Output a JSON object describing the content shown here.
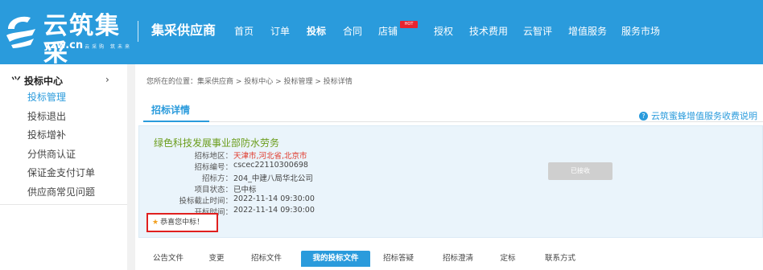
{
  "header": {
    "logo_title": "云筑集采",
    "logo_domain": "yzw.cn",
    "logo_tagline": "云采购 筑未来",
    "brand": "集采供应商",
    "nav": [
      {
        "label": "首页"
      },
      {
        "label": "订单"
      },
      {
        "label": "投标",
        "active": true
      },
      {
        "label": "合同"
      },
      {
        "label": "店铺",
        "badge": "HOT"
      },
      {
        "label": "授权"
      },
      {
        "label": "技术费用"
      },
      {
        "label": "云智评"
      },
      {
        "label": "增值服务"
      },
      {
        "label": "服务市场"
      }
    ]
  },
  "sidebar": {
    "section_label": "投标中心",
    "section_icon": "bid-hammer-icon",
    "items": [
      {
        "label": "投标管理",
        "active": true
      },
      {
        "label": "投标退出"
      },
      {
        "label": "投标增补"
      },
      {
        "label": "分供商认证"
      },
      {
        "label": "保证金支付订单"
      },
      {
        "label": "供应商常见问题"
      }
    ]
  },
  "main": {
    "breadcrumb": "您所在的位置：集采供应商 > 投标中心 > 投标管理 > 投标详情",
    "section_title": "招标详情",
    "help_link": "云筑蜜蜂增值服务收费说明",
    "project": {
      "title": "绿色科技发展事业部防水劳务",
      "fields": [
        {
          "label": "招标地区：",
          "value": "天津市,河北省,北京市",
          "highlight": true
        },
        {
          "label": "招标编号：",
          "value": "cscec22110300698"
        },
        {
          "label": "招标方：",
          "value": "204_中建八局华北公司"
        },
        {
          "label": "项目状态：",
          "value": "已中标"
        },
        {
          "label": "投标截止时间：",
          "value": "2022-11-14 09:30:00"
        },
        {
          "label": "开标时间：",
          "value": "2022-11-14 09:30:00"
        }
      ],
      "status_button": "已接收",
      "congrats": "恭喜您中标！"
    },
    "tabs": [
      {
        "label": "公告文件"
      },
      {
        "label": "变更"
      },
      {
        "label": "招标文件"
      },
      {
        "label": "我的投标文件",
        "active": true
      },
      {
        "label": "招标答疑"
      },
      {
        "label": "招标澄清"
      },
      {
        "label": "定标"
      },
      {
        "label": "联系方式"
      }
    ]
  },
  "colors": {
    "accent": "#2a9bdc",
    "title_green": "#6a9c1a",
    "region_red": "#e0392b",
    "highlight_border": "#e0201f"
  }
}
